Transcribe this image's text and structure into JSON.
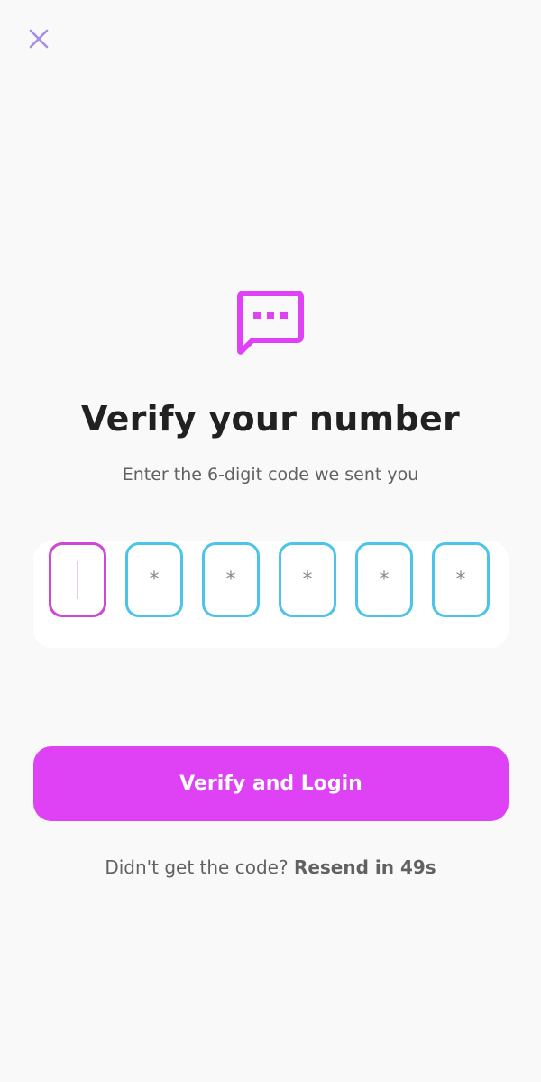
{
  "header": {
    "close_icon": "close-icon",
    "close_color": "#a98be8"
  },
  "hero": {
    "icon": "chat-bubble-dots-icon",
    "icon_color": "#df42f4",
    "title": "Verify your number",
    "subtitle": "Enter the 6-digit code we sent you"
  },
  "otp": {
    "length": 6,
    "active_index": 0,
    "placeholder": "*",
    "digits": [
      "",
      "*",
      "*",
      "*",
      "*",
      "*"
    ],
    "border_color": "#4cc3e8",
    "active_border_color": "#cf47d9"
  },
  "actions": {
    "verify_label": "Verify and Login",
    "verify_color": "#df42f4"
  },
  "resend": {
    "prompt": "Didn't get the code?",
    "link_label": "Resend in 49s"
  }
}
